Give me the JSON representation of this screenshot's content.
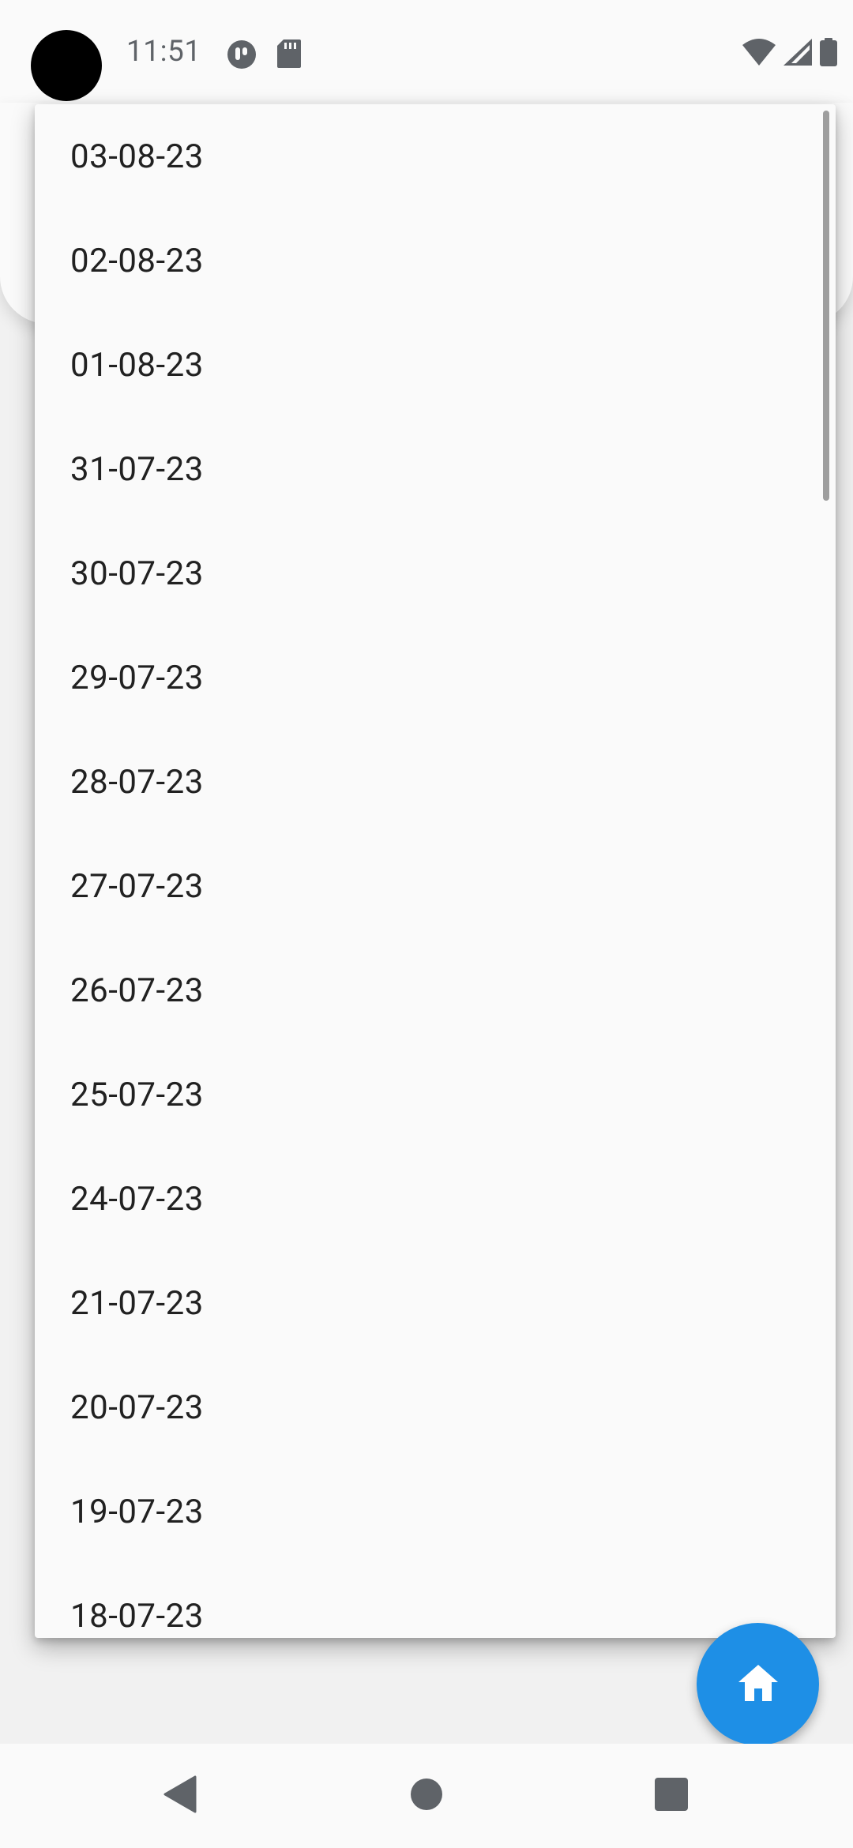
{
  "status_bar": {
    "time": "11:51",
    "left_icons": [
      "notification-app-icon",
      "sd-card-icon"
    ],
    "right_icons": [
      "wifi-icon",
      "cell-signal-icon",
      "battery-icon"
    ]
  },
  "dropdown": {
    "items": [
      "03-08-23",
      "02-08-23",
      "01-08-23",
      "31-07-23",
      "30-07-23",
      "29-07-23",
      "28-07-23",
      "27-07-23",
      "26-07-23",
      "25-07-23",
      "24-07-23",
      "21-07-23",
      "20-07-23",
      "19-07-23",
      "18-07-23"
    ]
  },
  "fab": {
    "icon": "home-icon",
    "color": "#1e8fe6"
  },
  "nav_bar": {
    "buttons": [
      "back-icon",
      "home-circle-icon",
      "recents-icon"
    ]
  }
}
